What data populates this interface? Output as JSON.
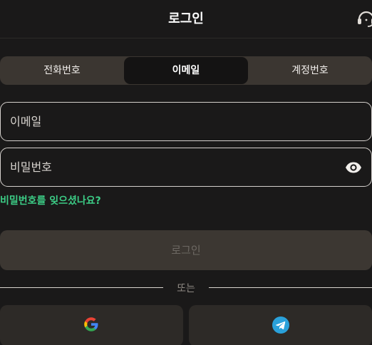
{
  "header": {
    "title": "로그인",
    "support_icon": "headset-icon"
  },
  "tabs": [
    {
      "label": "전화번호",
      "active": false
    },
    {
      "label": "이메일",
      "active": true
    },
    {
      "label": "계정번호",
      "active": false
    }
  ],
  "form": {
    "email_placeholder": "이메일",
    "email_value": "",
    "password_placeholder": "비밀번호",
    "password_value": "",
    "eye_icon": "eye-icon",
    "forgot_label": "비밀번호를 잊으셨나요?",
    "login_label": "로그인"
  },
  "divider": {
    "label": "또는"
  },
  "social": {
    "google_icon": "google-icon",
    "telegram_icon": "telegram-icon"
  },
  "colors": {
    "background": "#1a1919",
    "accent_green": "#3ccd86",
    "tab_bar": "#3b3631",
    "active_tab": "#141313",
    "button_disabled": "#3c3732",
    "social_button": "#2d2a27",
    "telegram_blue": "#2aa1da"
  }
}
